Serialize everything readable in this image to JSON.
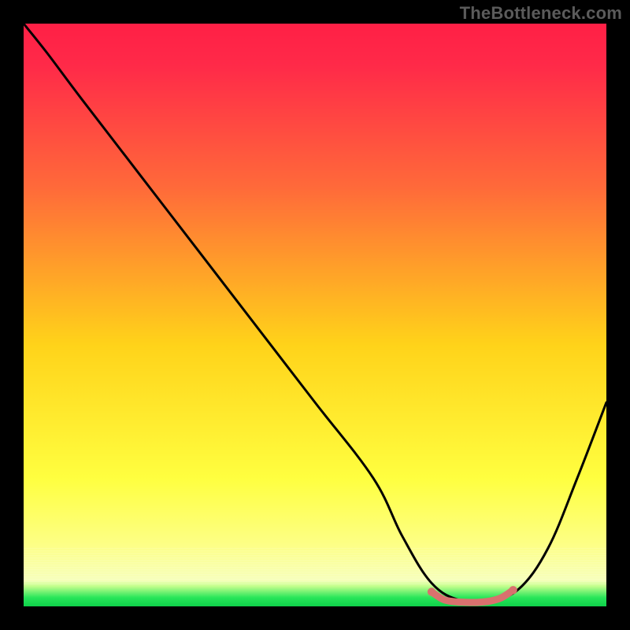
{
  "watermark": "TheBottleneck.com",
  "colors": {
    "frame": "#000000",
    "watermark": "#5b5b5b",
    "curve": "#000000",
    "marker": "#d8716e",
    "gradient_top": "#ff2046",
    "gradient_mid1": "#ff6a3a",
    "gradient_mid2": "#ffd31a",
    "gradient_mid3": "#ffff5a",
    "gradient_band": "#fbffb0",
    "gradient_bottom": "#12e052"
  },
  "chart_data": {
    "type": "line",
    "title": "",
    "xlabel": "",
    "ylabel": "",
    "x_range": [
      0,
      100
    ],
    "y_range": [
      0,
      100
    ],
    "background": "vertical rainbow gradient (red → orange → yellow → pale-yellow → green bottom stripe)",
    "series": [
      {
        "name": "curve",
        "color": "#000000",
        "x": [
          0,
          4,
          10,
          20,
          30,
          40,
          50,
          60,
          65,
          70,
          75,
          80,
          85,
          90,
          95,
          100
        ],
        "y": [
          100,
          95,
          87,
          74,
          61,
          48,
          35,
          22,
          12,
          4,
          1,
          1,
          3,
          10,
          22,
          35
        ]
      }
    ],
    "annotations": [
      {
        "name": "optimal-band",
        "type": "marker-segment",
        "color": "#d8716e",
        "x": [
          70,
          72,
          74,
          76,
          78,
          80,
          82,
          84
        ],
        "y": [
          2.5,
          1.2,
          0.8,
          0.7,
          0.7,
          0.9,
          1.5,
          2.8
        ]
      }
    ]
  }
}
